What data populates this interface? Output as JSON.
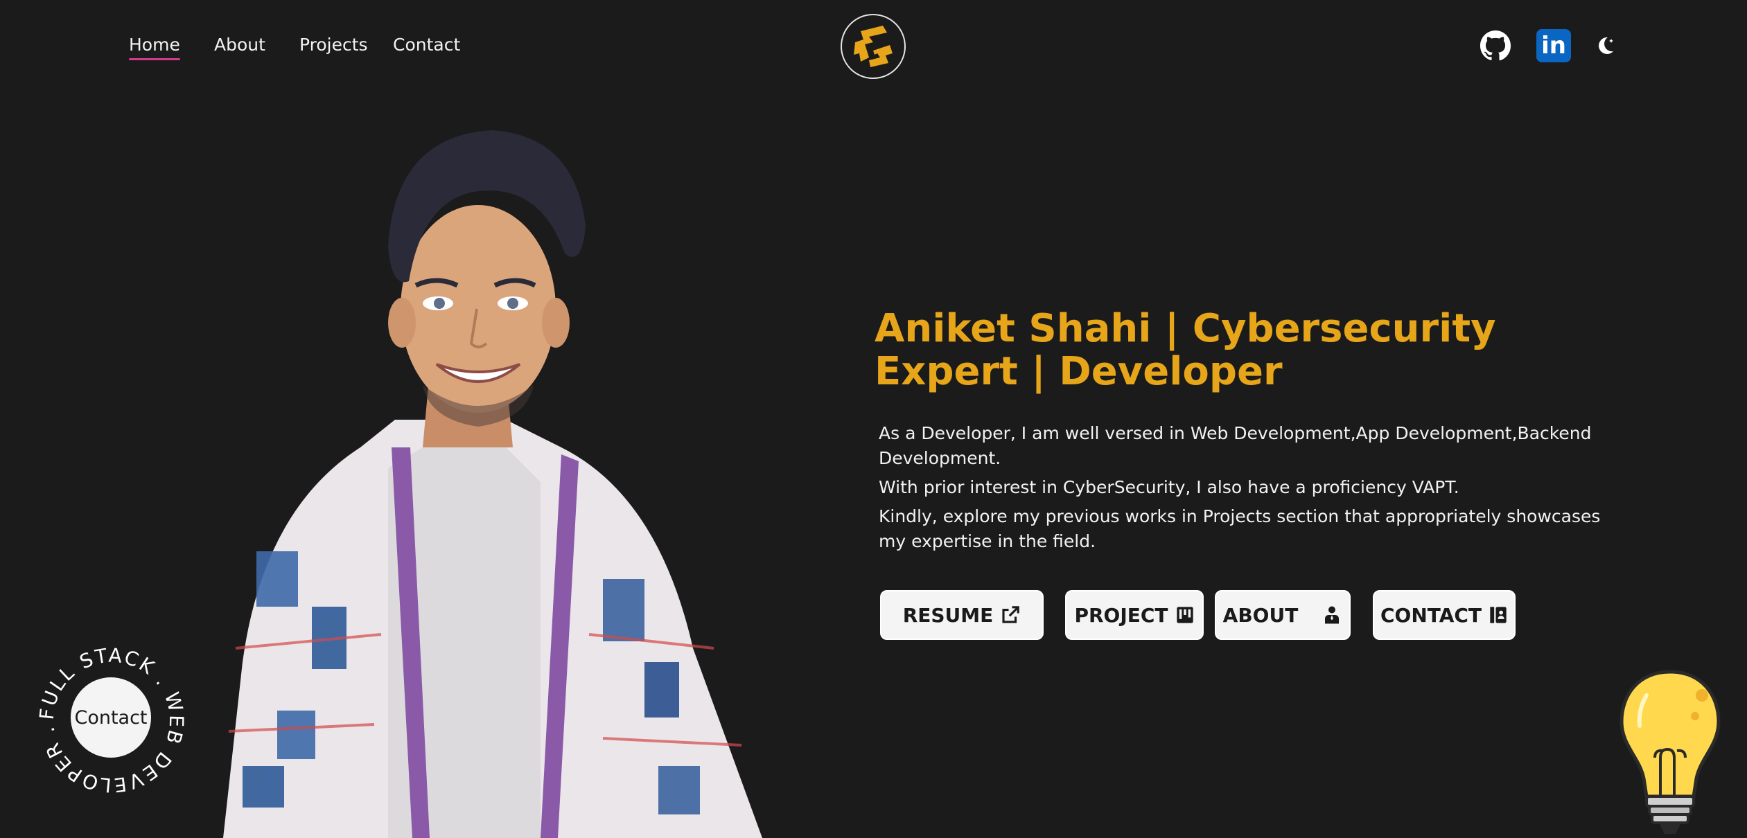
{
  "nav": {
    "items": [
      {
        "label": "Home",
        "active": true
      },
      {
        "label": "About",
        "active": false
      },
      {
        "label": "Projects",
        "active": false
      },
      {
        "label": "Contact",
        "active": false
      }
    ]
  },
  "header": {
    "logo_icon": "monogram-logo",
    "social": [
      {
        "icon": "github-icon"
      },
      {
        "icon": "linkedin-icon",
        "label": "in"
      },
      {
        "icon": "moon-icon"
      }
    ]
  },
  "hero": {
    "headline": "Aniket Shahi | Cybersecurity Expert | Developer",
    "paragraphs": [
      "As a Developer, I am well versed in Web Development,App Development,Backend Development.",
      "With prior interest in CyberSecurity, I also have a proficiency VAPT.",
      "Kindly, explore my previous works in Projects section that appropriately showcases my expertise in the field."
    ],
    "buttons": [
      {
        "label": "RESUME",
        "icon": "external-link-icon"
      },
      {
        "label": "PROJECT",
        "icon": "kanban-icon"
      },
      {
        "label": "ABOUT",
        "icon": "person-icon"
      },
      {
        "label": "CONTACT",
        "icon": "contact-card-icon"
      }
    ]
  },
  "badge": {
    "ring_text": "FULL STACK . WEB DEVELOPER .",
    "center_label": "Contact"
  },
  "colors": {
    "background": "#1b1b1b",
    "accent": "#e7a51a",
    "active_underline": "#d33a8f",
    "linkedin": "#0a66c2"
  }
}
